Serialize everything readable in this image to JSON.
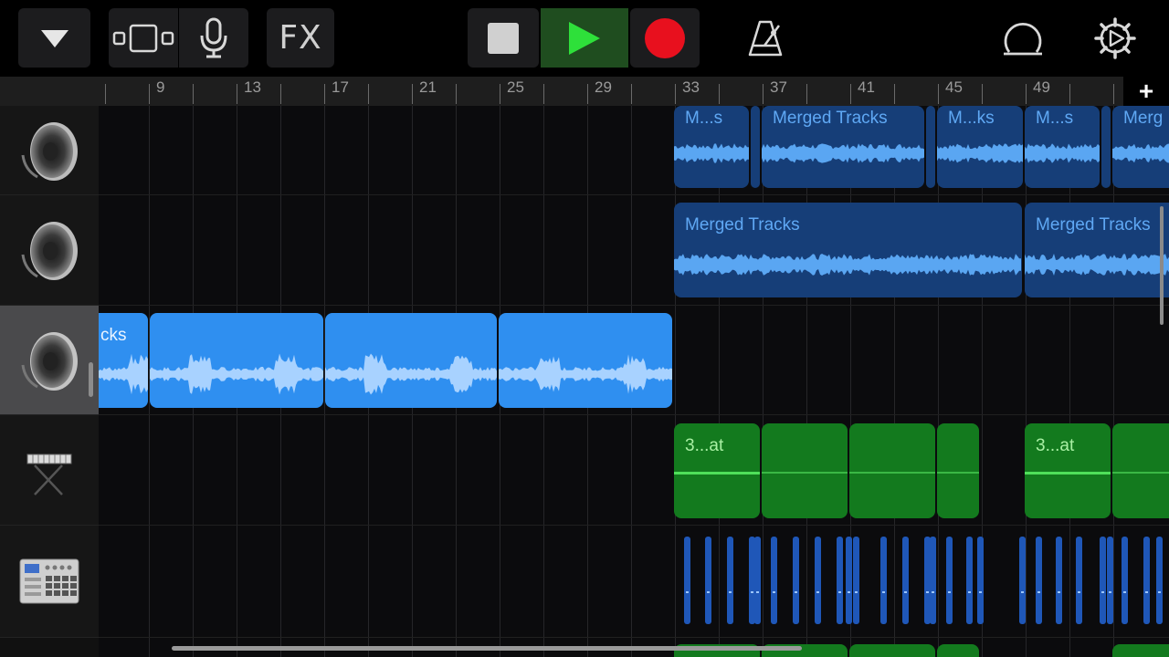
{
  "toolbar": {
    "menu_icon": "triangle-down-icon",
    "view_icon": "tracks-view-icon",
    "mic_icon": "microphone-icon",
    "fx_label": "FX",
    "stop_icon": "stop-icon",
    "play_icon": "play-icon",
    "record_icon": "record-icon",
    "metronome_icon": "metronome-icon",
    "loop_icon": "loop-icon",
    "settings_icon": "gear-icon"
  },
  "ruler": {
    "bars": [
      "9",
      "13",
      "17",
      "21",
      "25",
      "29",
      "33",
      "37",
      "41",
      "45",
      "49"
    ],
    "add_label": "+"
  },
  "tracks": [
    {
      "instrument_icon": "speaker-icon",
      "selected": false
    },
    {
      "instrument_icon": "speaker-icon",
      "selected": false
    },
    {
      "instrument_icon": "speaker-icon",
      "selected": true
    },
    {
      "instrument_icon": "keyboard-icon",
      "selected": false
    },
    {
      "instrument_icon": "drum-machine-icon",
      "selected": false
    }
  ],
  "regions": {
    "track1": [
      "M...s",
      "Merged Tracks",
      "M...ks",
      "M...s",
      "Merg"
    ],
    "track2": [
      "Merged Tracks",
      "Merged Tracks"
    ],
    "track3": [
      "cks"
    ],
    "track4": [
      "3...at",
      "3...at"
    ]
  },
  "colors": {
    "play_active": "#1f4d1f",
    "record": "#e8101e",
    "audio_region_dark": "#163e78",
    "audio_region_bright": "#2f8ff0",
    "midi_region": "#137a1e",
    "midi_line": "#4fe05a"
  }
}
